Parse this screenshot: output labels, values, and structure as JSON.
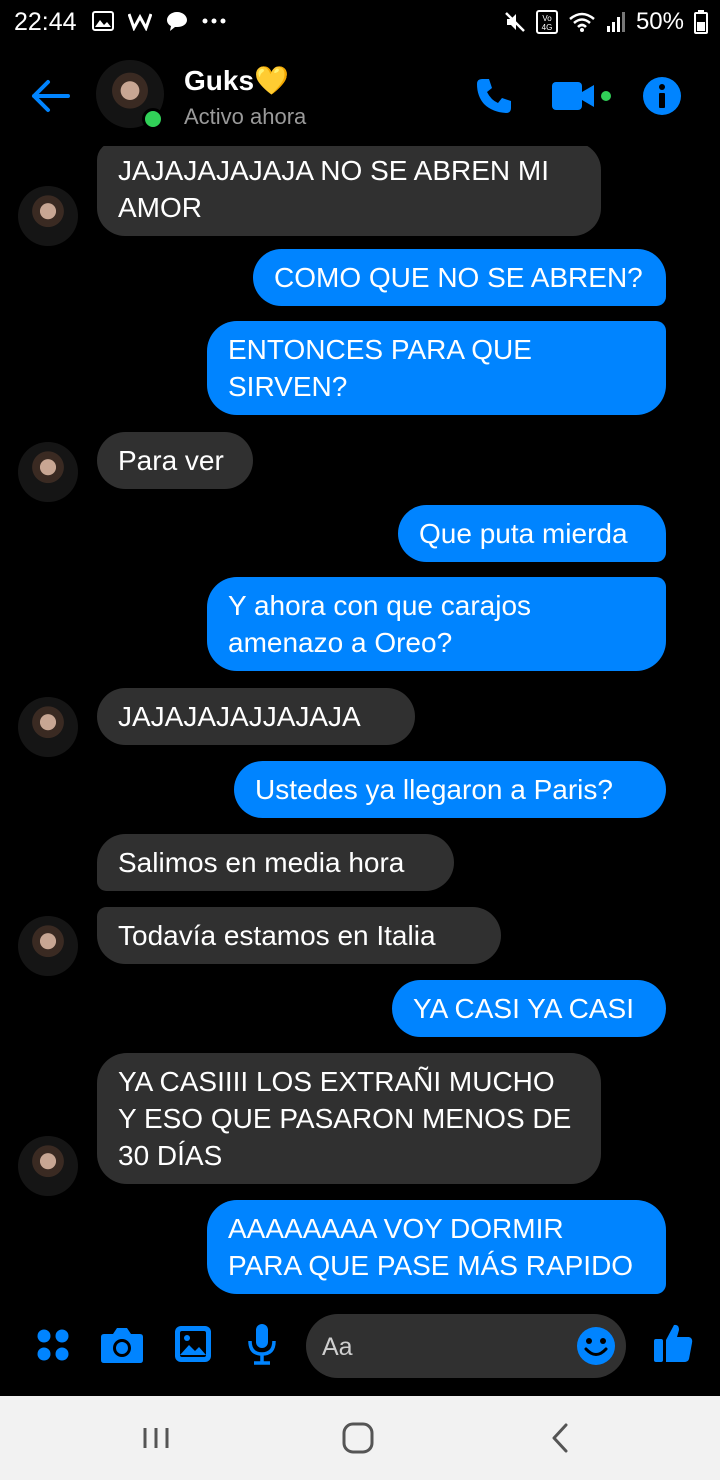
{
  "status_bar": {
    "time": "22:44",
    "battery": "50%",
    "network": "4G",
    "icons": [
      "gallery-icon",
      "w-app-icon",
      "chat-bubble-icon",
      "more-dots-icon",
      "mute-icon",
      "volte-icon",
      "wifi-icon",
      "signal-icon",
      "battery-icon"
    ]
  },
  "header": {
    "contact_name": "Guks💛",
    "status": "Activo ahora",
    "accent": "#0084ff",
    "online_color": "#31d158"
  },
  "messages": [
    {
      "dir": "in",
      "text": "JAJAJAJAJAJA NO SE ABREN MI AMOR",
      "avatar": true
    },
    {
      "dir": "out",
      "text": "COMO QUE NO SE ABREN?"
    },
    {
      "dir": "out",
      "text": "ENTONCES PARA QUE SIRVEN?"
    },
    {
      "dir": "in",
      "text": "Para ver",
      "avatar": true
    },
    {
      "dir": "out",
      "text": "Que puta mierda"
    },
    {
      "dir": "out",
      "text": "Y ahora con que carajos amenazo a Oreo?"
    },
    {
      "dir": "in",
      "text": "JAJAJAJAJJAJAJA",
      "avatar": true
    },
    {
      "dir": "out",
      "text": "Ustedes ya llegaron a Paris?"
    },
    {
      "dir": "in",
      "text": "Salimos en media hora",
      "avatar": false
    },
    {
      "dir": "in",
      "text": "Todavía estamos en Italia",
      "avatar": true
    },
    {
      "dir": "out",
      "text": "YA CASI YA CASI"
    },
    {
      "dir": "in",
      "text": "YA CASIIII LOS EXTRAÑI MUCHO Y ESO QUE PASARON MENOS DE 30 DÍAS",
      "avatar": true
    },
    {
      "dir": "out",
      "text": "AAAAAAAA VOY DORMIR PARA QUE PASE MÁS RAPIDO"
    }
  ],
  "composer": {
    "placeholder": "Aa"
  },
  "colors": {
    "incoming_bubble": "#303030",
    "outgoing_bubble": "#0084ff",
    "background": "#000000"
  }
}
